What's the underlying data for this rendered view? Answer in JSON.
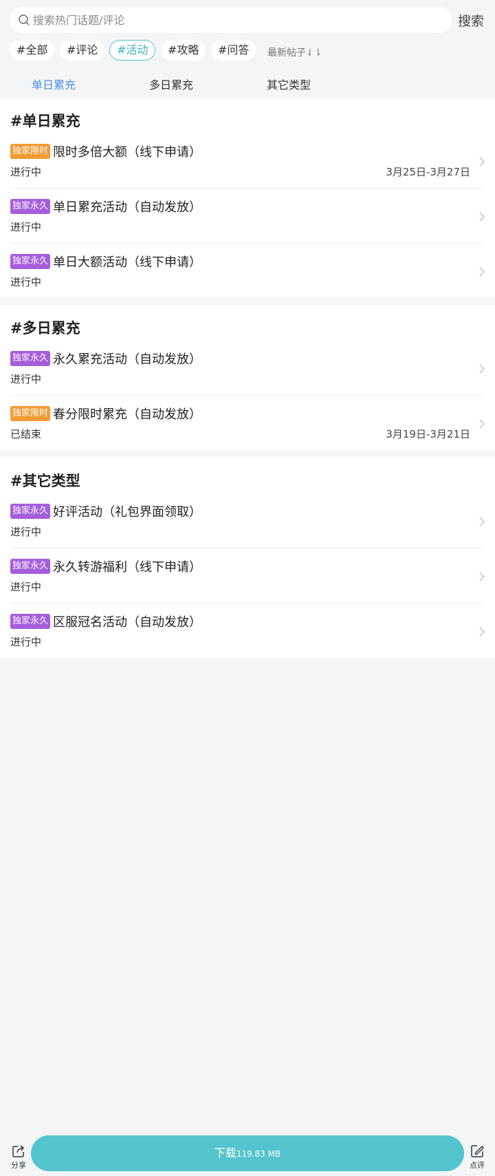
{
  "search": {
    "placeholder": "搜索热门话题/评论",
    "value": "",
    "button_label": "搜索"
  },
  "tags": [
    {
      "label": "#全部",
      "active": false
    },
    {
      "label": "#评论",
      "active": false
    },
    {
      "label": "#活动",
      "active": true
    },
    {
      "label": "#攻略",
      "active": false
    },
    {
      "label": "#问答",
      "active": false
    }
  ],
  "sort_label": "最新帖子⇃⇂",
  "tabs": [
    {
      "label": "单日累充",
      "active": true
    },
    {
      "label": "多日累充",
      "active": false
    },
    {
      "label": "其它类型",
      "active": false
    }
  ],
  "sections": [
    {
      "title": "#单日累充",
      "items": [
        {
          "badge": "独家限时",
          "badge_type": "limited",
          "title": "限时多倍大额（线下申请）",
          "status": "进行中",
          "date": "3月25日-3月27日"
        },
        {
          "badge": "独家永久",
          "badge_type": "perm",
          "title": "单日累充活动（自动发放）",
          "status": "进行中",
          "date": ""
        },
        {
          "badge": "独家永久",
          "badge_type": "perm",
          "title": "单日大额活动（线下申请）",
          "status": "进行中",
          "date": ""
        }
      ]
    },
    {
      "title": "#多日累充",
      "items": [
        {
          "badge": "独家永久",
          "badge_type": "perm",
          "title": "永久累充活动（自动发放）",
          "status": "进行中",
          "date": ""
        },
        {
          "badge": "独家限时",
          "badge_type": "limited",
          "title": "春分限时累充（自动发放）",
          "status": "已结束",
          "date": "3月19日-3月21日"
        }
      ]
    },
    {
      "title": "#其它类型",
      "items": [
        {
          "badge": "独家永久",
          "badge_type": "perm",
          "title": "好评活动（礼包界面领取）",
          "status": "进行中",
          "date": ""
        },
        {
          "badge": "独家永久",
          "badge_type": "perm",
          "title": "永久转游福利（线下申请）",
          "status": "进行中",
          "date": ""
        },
        {
          "badge": "独家永久",
          "badge_type": "perm",
          "title": "区服冠名活动（自动发放）",
          "status": "进行中",
          "date": ""
        }
      ]
    }
  ],
  "bottom": {
    "share_label": "分享",
    "download_label": "下载",
    "download_size": "119.83 MB",
    "review_label": "点评"
  },
  "colors": {
    "accent": "#54c4cf",
    "tab_active": "#4a90e2",
    "badge_limited": "#f29b35",
    "badge_perm": "#a65ddc"
  }
}
